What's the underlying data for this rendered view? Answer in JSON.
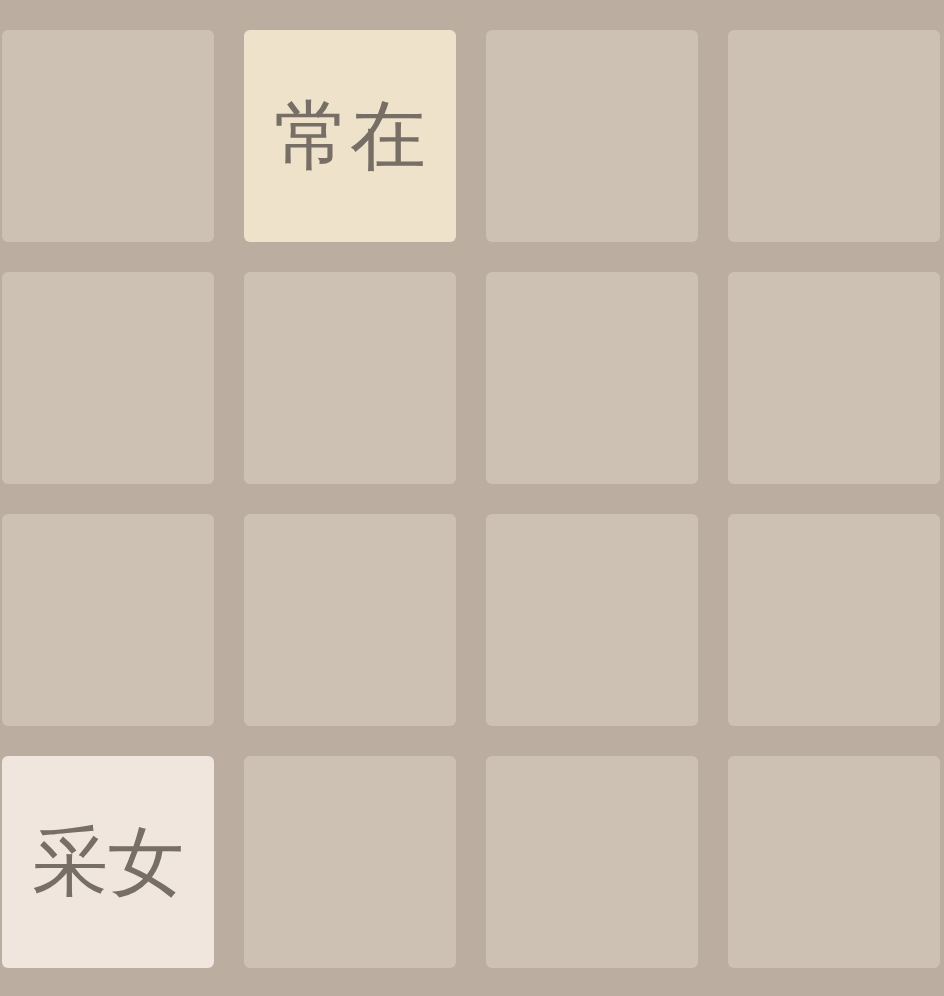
{
  "board": {
    "rows": [
      [
        {
          "kind": "empty"
        },
        {
          "kind": "tile",
          "text": "常在",
          "color": "#eee3ca"
        },
        {
          "kind": "empty"
        },
        {
          "kind": "empty"
        }
      ],
      [
        {
          "kind": "empty"
        },
        {
          "kind": "empty"
        },
        {
          "kind": "empty"
        },
        {
          "kind": "empty"
        }
      ],
      [
        {
          "kind": "empty"
        },
        {
          "kind": "empty"
        },
        {
          "kind": "empty"
        },
        {
          "kind": "empty"
        }
      ],
      [
        {
          "kind": "tile",
          "text": "采女",
          "color": "#f0e6de"
        },
        {
          "kind": "empty"
        },
        {
          "kind": "empty"
        },
        {
          "kind": "empty"
        }
      ]
    ]
  }
}
